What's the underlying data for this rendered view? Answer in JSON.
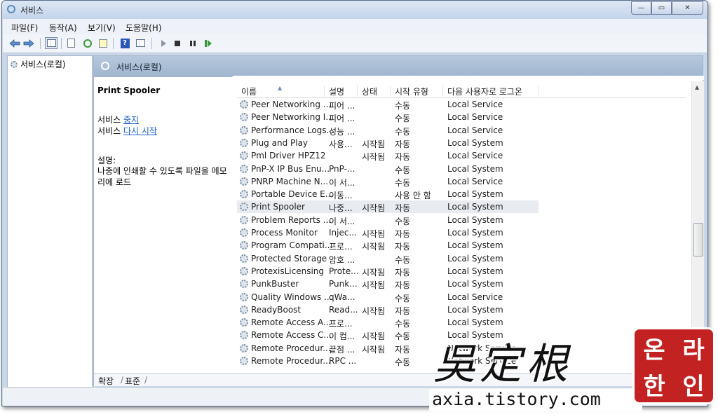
{
  "window": {
    "title": "서비스",
    "buttons": {
      "minimize": "—",
      "maximize": "▭",
      "close": "✕"
    }
  },
  "menu": [
    "파일(F)",
    "동작(A)",
    "보기(V)",
    "도움말(H)"
  ],
  "tree": {
    "root": "서비스(로컬)"
  },
  "content_header": {
    "title": "서비스(로컬)"
  },
  "details": {
    "service_name": "Print Spooler",
    "action1_prefix": "서비스 ",
    "action1_link": "중지",
    "action2_prefix": "서비스 ",
    "action2_link": "다시 시작",
    "desc_label": "설명:",
    "desc_text": "나중에 인쇄할 수 있도록 파일을 메모리에 로드"
  },
  "columns": [
    "이름",
    "설명",
    "상태",
    "시작 유형",
    "다음 사용자로 로그온"
  ],
  "rows": [
    {
      "name": "Peer Networking ...",
      "desc": "피어 ...",
      "status": "",
      "startup": "수동",
      "logon": "Local Service"
    },
    {
      "name": "Peer Networking I...",
      "desc": "피어 ...",
      "status": "",
      "startup": "수동",
      "logon": "Local Service"
    },
    {
      "name": "Performance Logs...",
      "desc": "성능 ...",
      "status": "",
      "startup": "수동",
      "logon": "Local Service"
    },
    {
      "name": "Plug and Play",
      "desc": "사용...",
      "status": "시작됨",
      "startup": "자동",
      "logon": "Local System"
    },
    {
      "name": "Pml Driver HPZ12",
      "desc": "",
      "status": "시작됨",
      "startup": "자동",
      "logon": "Local Service"
    },
    {
      "name": "PnP-X IP Bus Enu...",
      "desc": "PnP-...",
      "status": "",
      "startup": "수동",
      "logon": "Local System"
    },
    {
      "name": "PNRP Machine N...",
      "desc": "이 서...",
      "status": "",
      "startup": "수동",
      "logon": "Local Service"
    },
    {
      "name": "Portable Device E...",
      "desc": "이동...",
      "status": "",
      "startup": "사용 안 함",
      "logon": "Local System"
    },
    {
      "name": "Print Spooler",
      "desc": "나중...",
      "status": "시작됨",
      "startup": "자동",
      "logon": "Local System",
      "selected": true
    },
    {
      "name": "Problem Reports ...",
      "desc": "이 서...",
      "status": "",
      "startup": "수동",
      "logon": "Local System"
    },
    {
      "name": "Process Monitor",
      "desc": "Injec...",
      "status": "시작됨",
      "startup": "자동",
      "logon": "Local System"
    },
    {
      "name": "Program Compati...",
      "desc": "프로...",
      "status": "시작됨",
      "startup": "자동",
      "logon": "Local System"
    },
    {
      "name": "Protected Storage",
      "desc": "암호 ...",
      "status": "",
      "startup": "수동",
      "logon": "Local System"
    },
    {
      "name": "ProtexisLicensing",
      "desc": "Prote...",
      "status": "시작됨",
      "startup": "자동",
      "logon": "Local System"
    },
    {
      "name": "PunkBuster",
      "desc": "Punk...",
      "status": "시작됨",
      "startup": "자동",
      "logon": "Local System"
    },
    {
      "name": "Quality Windows ...",
      "desc": "qWa...",
      "status": "",
      "startup": "수동",
      "logon": "Local Service"
    },
    {
      "name": "ReadyBoost",
      "desc": "Read...",
      "status": "시작됨",
      "startup": "자동",
      "logon": "Local System"
    },
    {
      "name": "Remote Access A...",
      "desc": "프로...",
      "status": "",
      "startup": "수동",
      "logon": "Local System"
    },
    {
      "name": "Remote Access C...",
      "desc": "이 컴...",
      "status": "시작됨",
      "startup": "수동",
      "logon": "Local System"
    },
    {
      "name": "Remote Procedur...",
      "desc": "끝점 ...",
      "status": "시작됨",
      "startup": "자동",
      "logon": "Network Service"
    },
    {
      "name": "Remote Procedur...",
      "desc": "RPC ...",
      "status": "",
      "startup": "수동",
      "logon": "Network Service"
    }
  ],
  "bottom_tabs": [
    "확장",
    "표준"
  ],
  "watermark": {
    "chars": "吳定根",
    "url": "axia.tistory.com",
    "seal": [
      "온",
      "라",
      "한",
      "인"
    ]
  }
}
